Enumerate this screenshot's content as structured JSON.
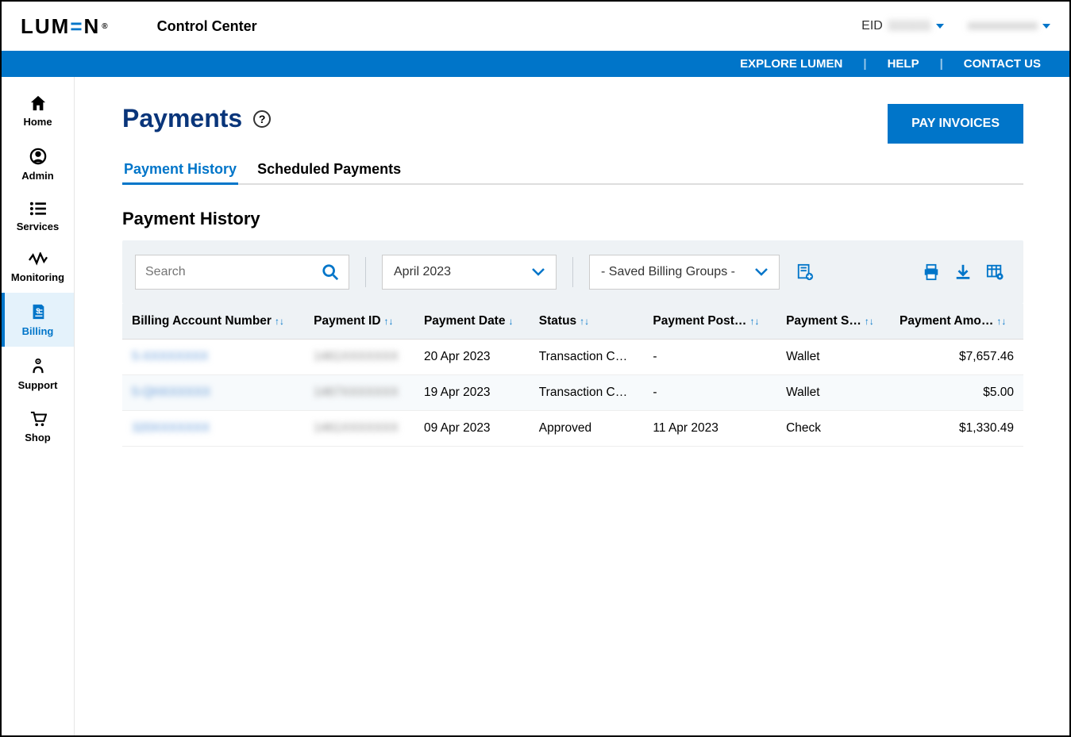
{
  "header": {
    "logo_text": "LUMEN",
    "breadcrumb": "Control Center",
    "eid_label": "EID",
    "eid_value": "1111111",
    "username": "xxxxxxxxxxx"
  },
  "navstrip": {
    "explore": "EXPLORE LUMEN",
    "help": "HELP",
    "contact": "CONTACT US"
  },
  "sidebar": {
    "items": [
      {
        "label": "Home"
      },
      {
        "label": "Admin"
      },
      {
        "label": "Services"
      },
      {
        "label": "Monitoring"
      },
      {
        "label": "Billing"
      },
      {
        "label": "Support"
      },
      {
        "label": "Shop"
      }
    ]
  },
  "page": {
    "title": "Payments",
    "pay_button": "PAY INVOICES",
    "tabs": {
      "history": "Payment History",
      "scheduled": "Scheduled Payments"
    },
    "section_title": "Payment History"
  },
  "filters": {
    "search_placeholder": "Search",
    "month": "April 2023",
    "billing_group": "- Saved Billing Groups -"
  },
  "columns": {
    "account": "Billing Account Number",
    "payment_id": "Payment ID",
    "date": "Payment Date",
    "status": "Status",
    "post": "Payment Post…",
    "source": "Payment S…",
    "amount": "Payment Amo…"
  },
  "rows": [
    {
      "account": "5-XXXXXXXX",
      "payment_id": "1461XXXXXXX",
      "date": "20 Apr 2023",
      "status": "Transaction C…",
      "post": "-",
      "source": "Wallet",
      "amount": "$7,657.46"
    },
    {
      "account": "5-QHXXXXXX",
      "payment_id": "1467XXXXXXX",
      "date": "19 Apr 2023",
      "status": "Transaction C…",
      "post": "-",
      "source": "Wallet",
      "amount": "$5.00"
    },
    {
      "account": "320XXXXXXX",
      "payment_id": "1461XXXXXXX",
      "date": "09 Apr 2023",
      "status": "Approved",
      "post": "11 Apr 2023",
      "source": "Check",
      "amount": "$1,330.49"
    }
  ]
}
